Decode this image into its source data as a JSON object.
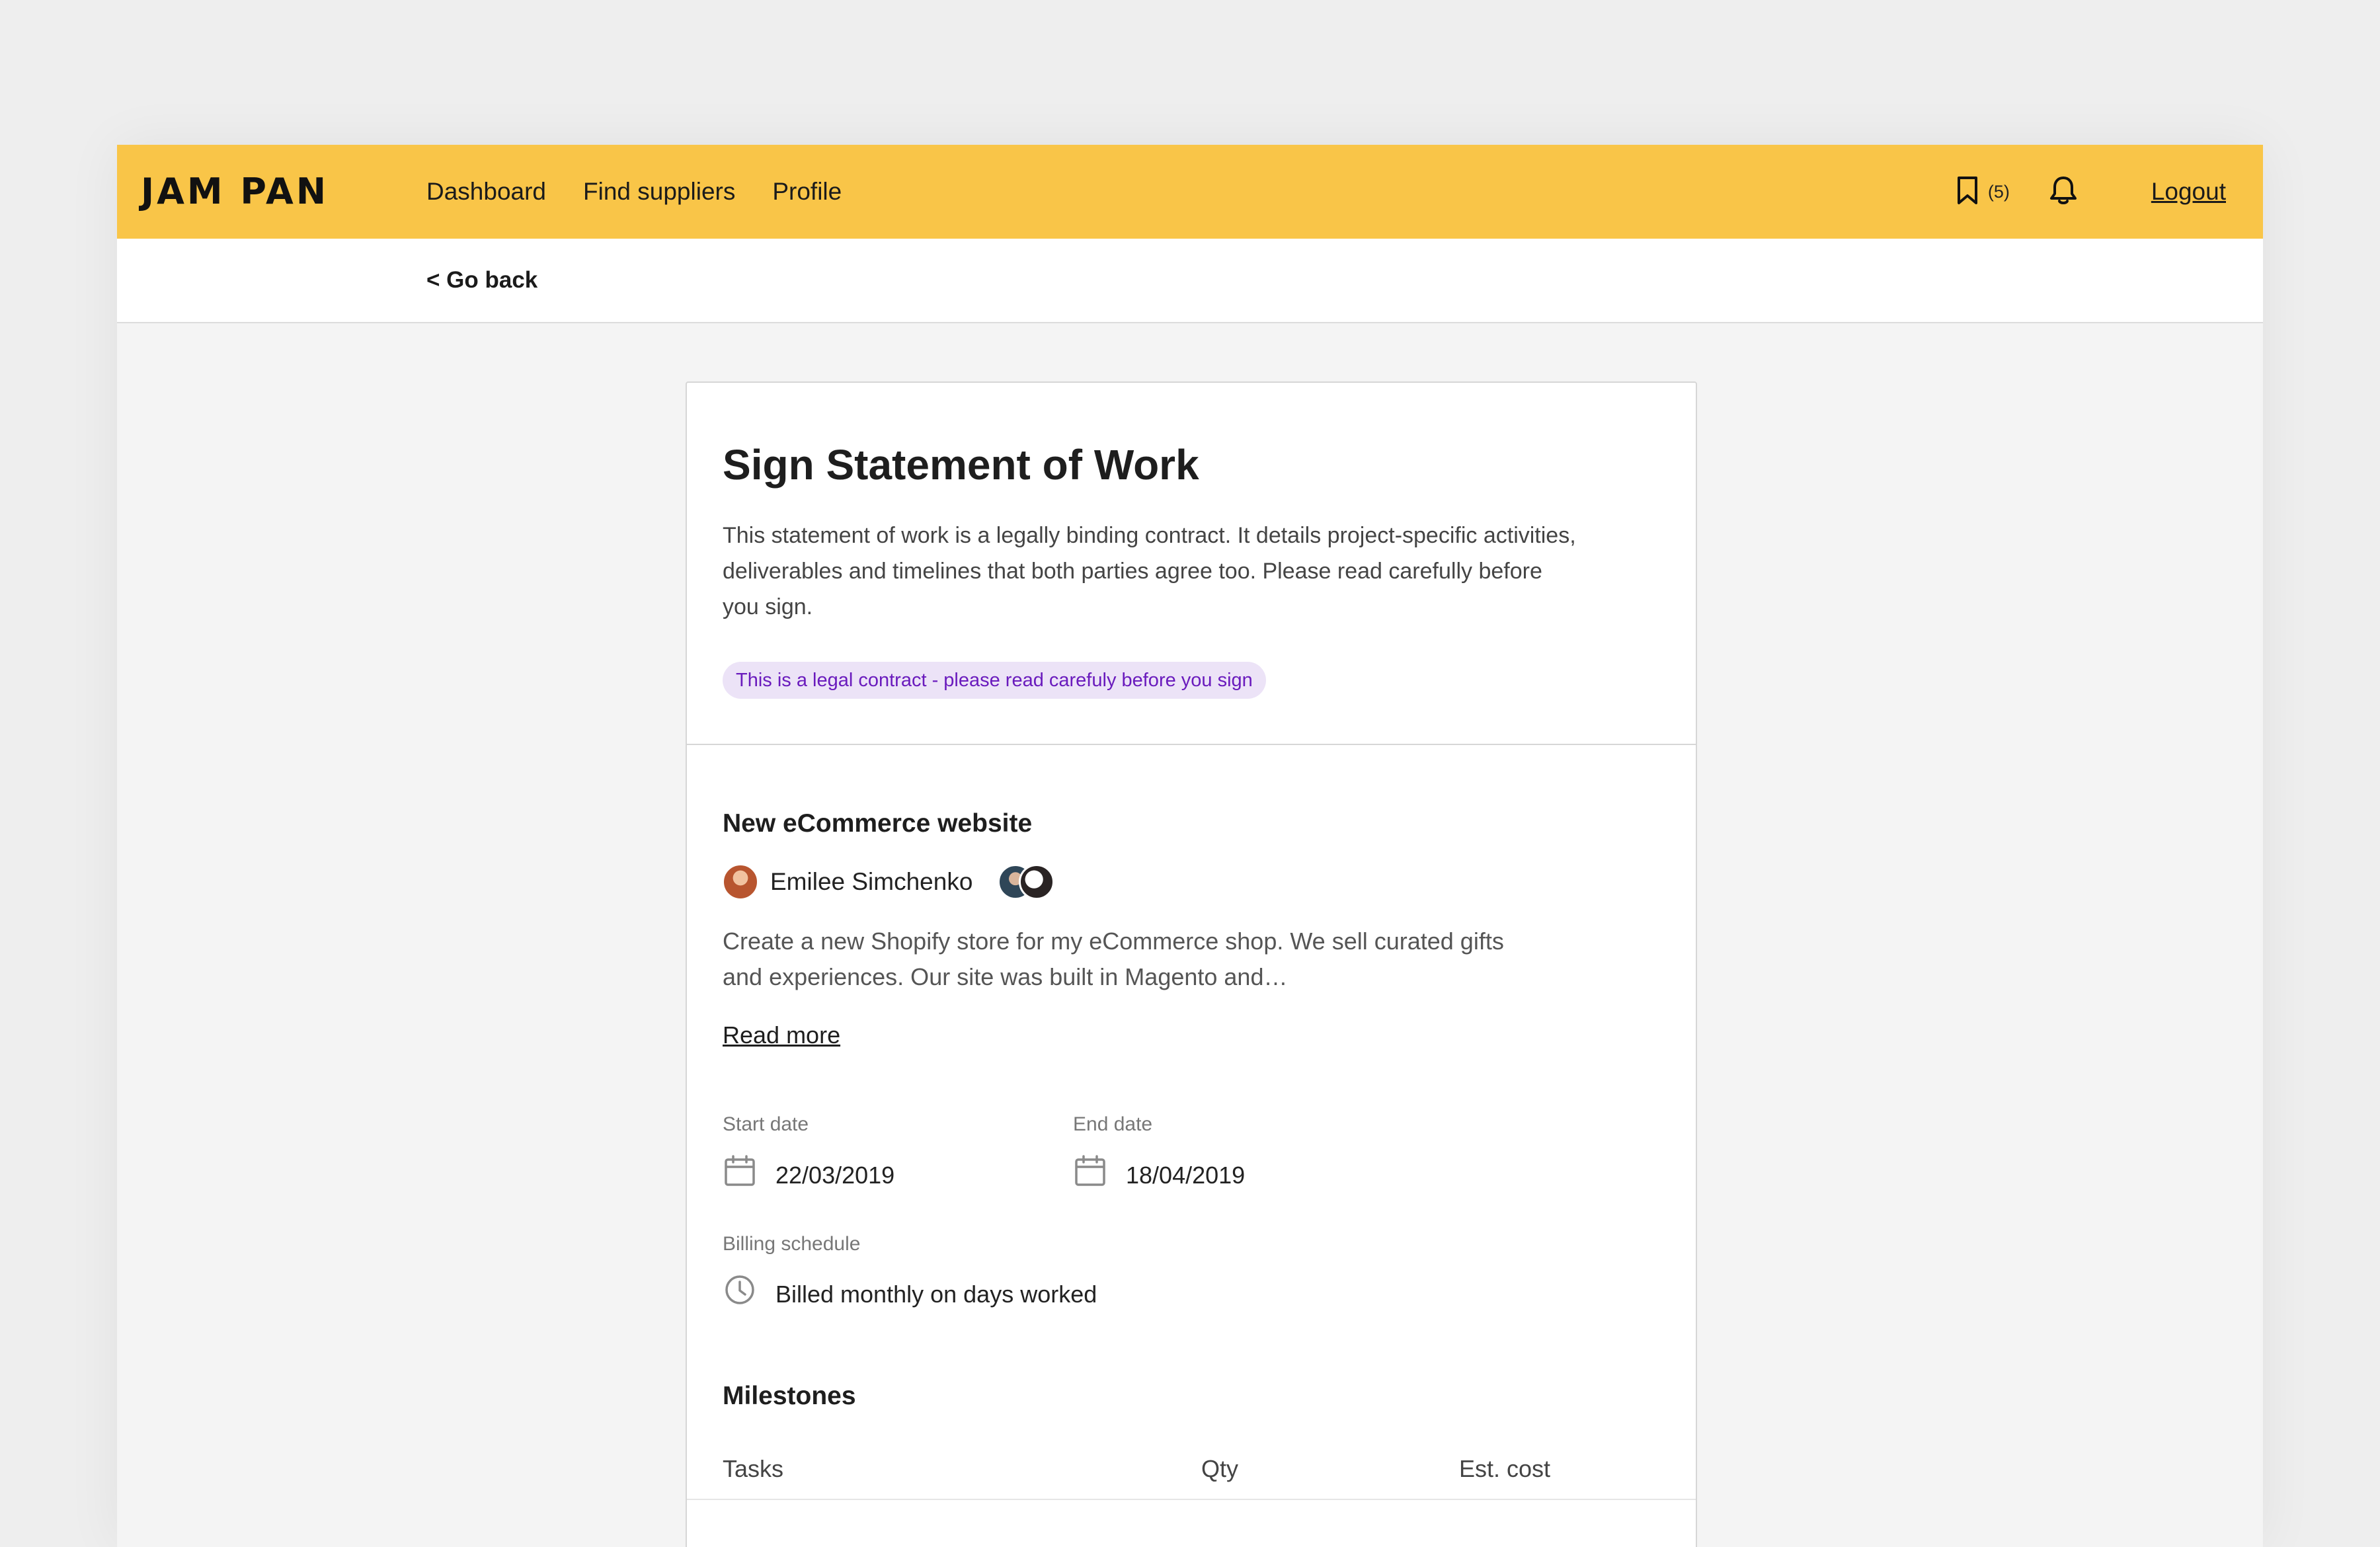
{
  "app": {
    "logo": "JAM PAN"
  },
  "nav": {
    "items": [
      {
        "label": "Dashboard"
      },
      {
        "label": "Find suppliers"
      },
      {
        "label": "Profile"
      }
    ],
    "bookmarks_count": "(5)",
    "logout_label": "Logout"
  },
  "subnav": {
    "go_back": "< Go back"
  },
  "page": {
    "title": "Sign Statement of Work",
    "intro": "This statement of work is a legally binding contract. It details project-specific activities, deliverables and timelines that both parties agree too. Please read carefully before you sign.",
    "legal_notice": "This is a legal contract - please read carefuly before you sign"
  },
  "project": {
    "title": "New eCommerce website",
    "owner_name": "Emilee Simchenko",
    "description": "Create a new Shopify store for my eCommerce shop. We sell curated gifts and experiences. Our site was built in Magento and…",
    "read_more": "Read more",
    "start_date_label": "Start date",
    "start_date": "22/03/2019",
    "end_date_label": "End date",
    "end_date": "18/04/2019",
    "billing_label": "Billing schedule",
    "billing_value": "Billed monthly on days worked"
  },
  "milestones": {
    "title": "Milestones",
    "columns": [
      "Tasks",
      "Qty",
      "Est. cost"
    ]
  },
  "colors": {
    "nav_bg": "#f9c548",
    "badge_bg": "#ece3f7",
    "badge_text": "#6a1bbd",
    "page_bg": "#f4f4f4"
  },
  "icons": {
    "bookmark": "bookmark-icon",
    "bell": "bell-icon",
    "calendar": "calendar-icon",
    "clock": "clock-icon"
  }
}
